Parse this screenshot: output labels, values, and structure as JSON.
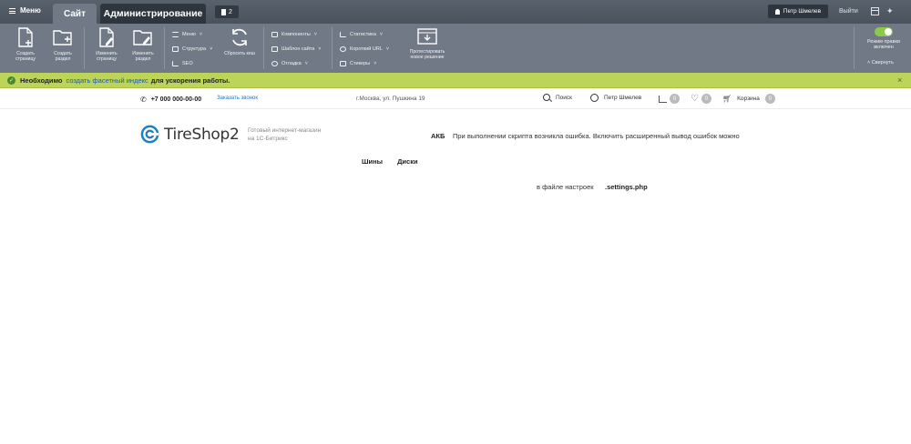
{
  "topbar": {
    "menu_label": "Меню",
    "tab_site": "Сайт",
    "tab_admin": "Администрирование",
    "notifications_count": "2",
    "user_name": "Петр Шмелев",
    "logout_label": "Выйти"
  },
  "toolbar": {
    "create_page": "Создать страницу",
    "create_section": "Создать раздел",
    "edit_page": "Изменить страницу",
    "edit_section": "Изменить раздел",
    "menu": "Меню",
    "structure": "Структура",
    "seo": "SEO",
    "reset_cache": "Сбросить кеш",
    "components": "Компоненты",
    "site_template": "Шаблон сайта",
    "debug": "Отладка",
    "statistics": "Статистика",
    "short_url": "Короткий URL",
    "stickers": "Стикеры",
    "test_solution": "Протестировать новое решение",
    "edit_mode": "Режим правки включен",
    "collapse": "Свернуть"
  },
  "notice": {
    "strong": "Необходимо",
    "link": "создать фасетный индекс",
    "tail": "для ускорения работы."
  },
  "site": {
    "phone": "+7 000 000-00-00",
    "callback": "Заказать звонок",
    "address": "г.Москва, ул. Пушкина 19",
    "search": "Поиск",
    "profile": "Петр Шмелев",
    "compare_count": "0",
    "favorites_count": "0",
    "cart_label": "Корзина",
    "cart_count": "0",
    "logo_text": "TireShop2",
    "slogan_line1": "Готовый интернет-магазин",
    "slogan_line2": "на 1С-Битрикс",
    "akb": "АКБ",
    "error_text": "При выполнении скрипта возникла ошибка. Включить расширенный вывод ошибок можно",
    "nav_tires": "Шины",
    "nav_disks": "Диски",
    "cfg_text": "в файле настроек",
    "cfg_file": ".settings.php"
  },
  "colors": {
    "topbar": "#4b5563",
    "toolbar": "#707985",
    "notice": "#bcd458",
    "link": "#2f74c0",
    "logo": "#1d7fc4"
  }
}
